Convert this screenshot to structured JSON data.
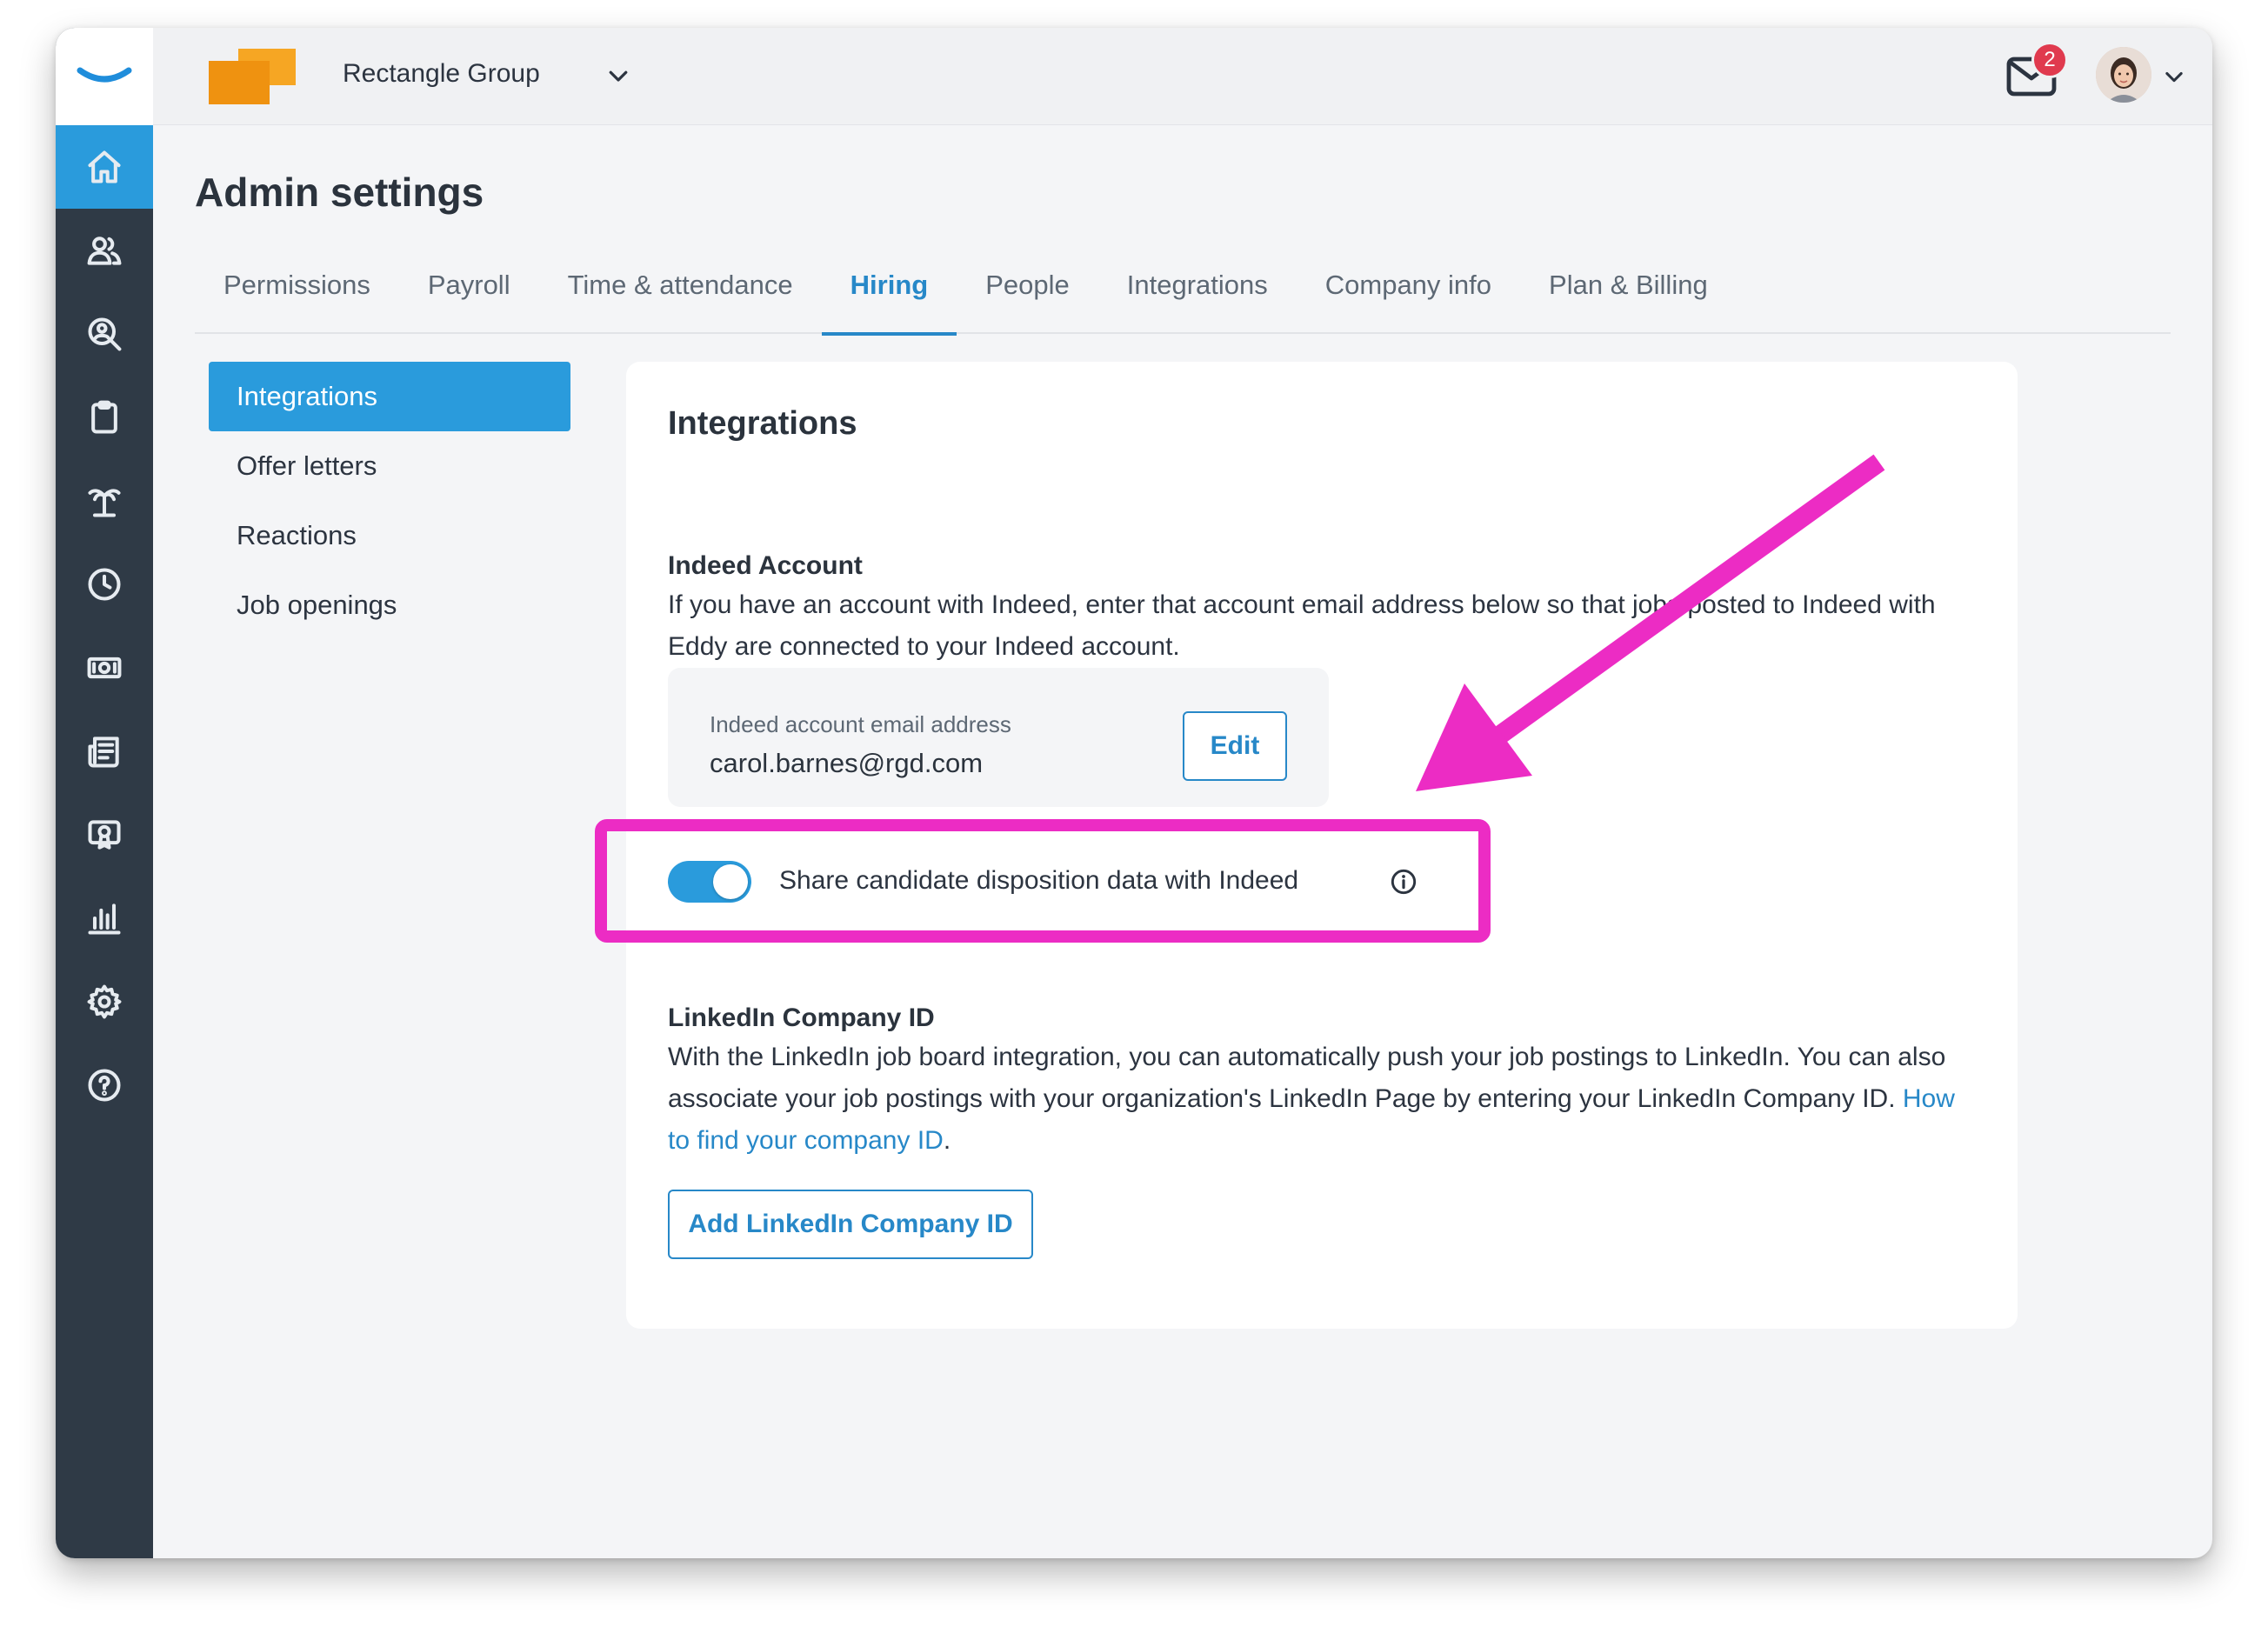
{
  "company": {
    "name": "Rectangle Group"
  },
  "notifications": {
    "count": "2"
  },
  "page": {
    "title": "Admin settings"
  },
  "tabs": [
    {
      "label": "Permissions"
    },
    {
      "label": "Payroll"
    },
    {
      "label": "Time & attendance"
    },
    {
      "label": "Hiring"
    },
    {
      "label": "People"
    },
    {
      "label": "Integrations"
    },
    {
      "label": "Company info"
    },
    {
      "label": "Plan & Billing"
    }
  ],
  "subnav": [
    {
      "label": "Integrations"
    },
    {
      "label": "Offer letters"
    },
    {
      "label": "Reactions"
    },
    {
      "label": "Job openings"
    }
  ],
  "card": {
    "title": "Integrations",
    "indeed": {
      "title": "Indeed Account",
      "description": "If you have an account with Indeed, enter that account email address below so that jobs posted to Indeed with Eddy are connected to your Indeed account.",
      "email_label": "Indeed account email address",
      "email_value": "carol.barnes@rgd.com",
      "edit_label": "Edit",
      "toggle_label": "Share candidate disposition data with Indeed",
      "toggle_on": true
    },
    "linkedin": {
      "title": "LinkedIn Company ID",
      "description": "With the LinkedIn job board integration, you can automatically push your job postings to LinkedIn. You can also associate your job postings with your organization's LinkedIn Page by entering your LinkedIn Company ID.",
      "link_text": "How to find your company ID",
      "button_label": "Add LinkedIn Company ID"
    }
  },
  "colors": {
    "accent": "#2a9bdc",
    "rail": "#2f3a46",
    "annotation": "#ec2cc4"
  }
}
